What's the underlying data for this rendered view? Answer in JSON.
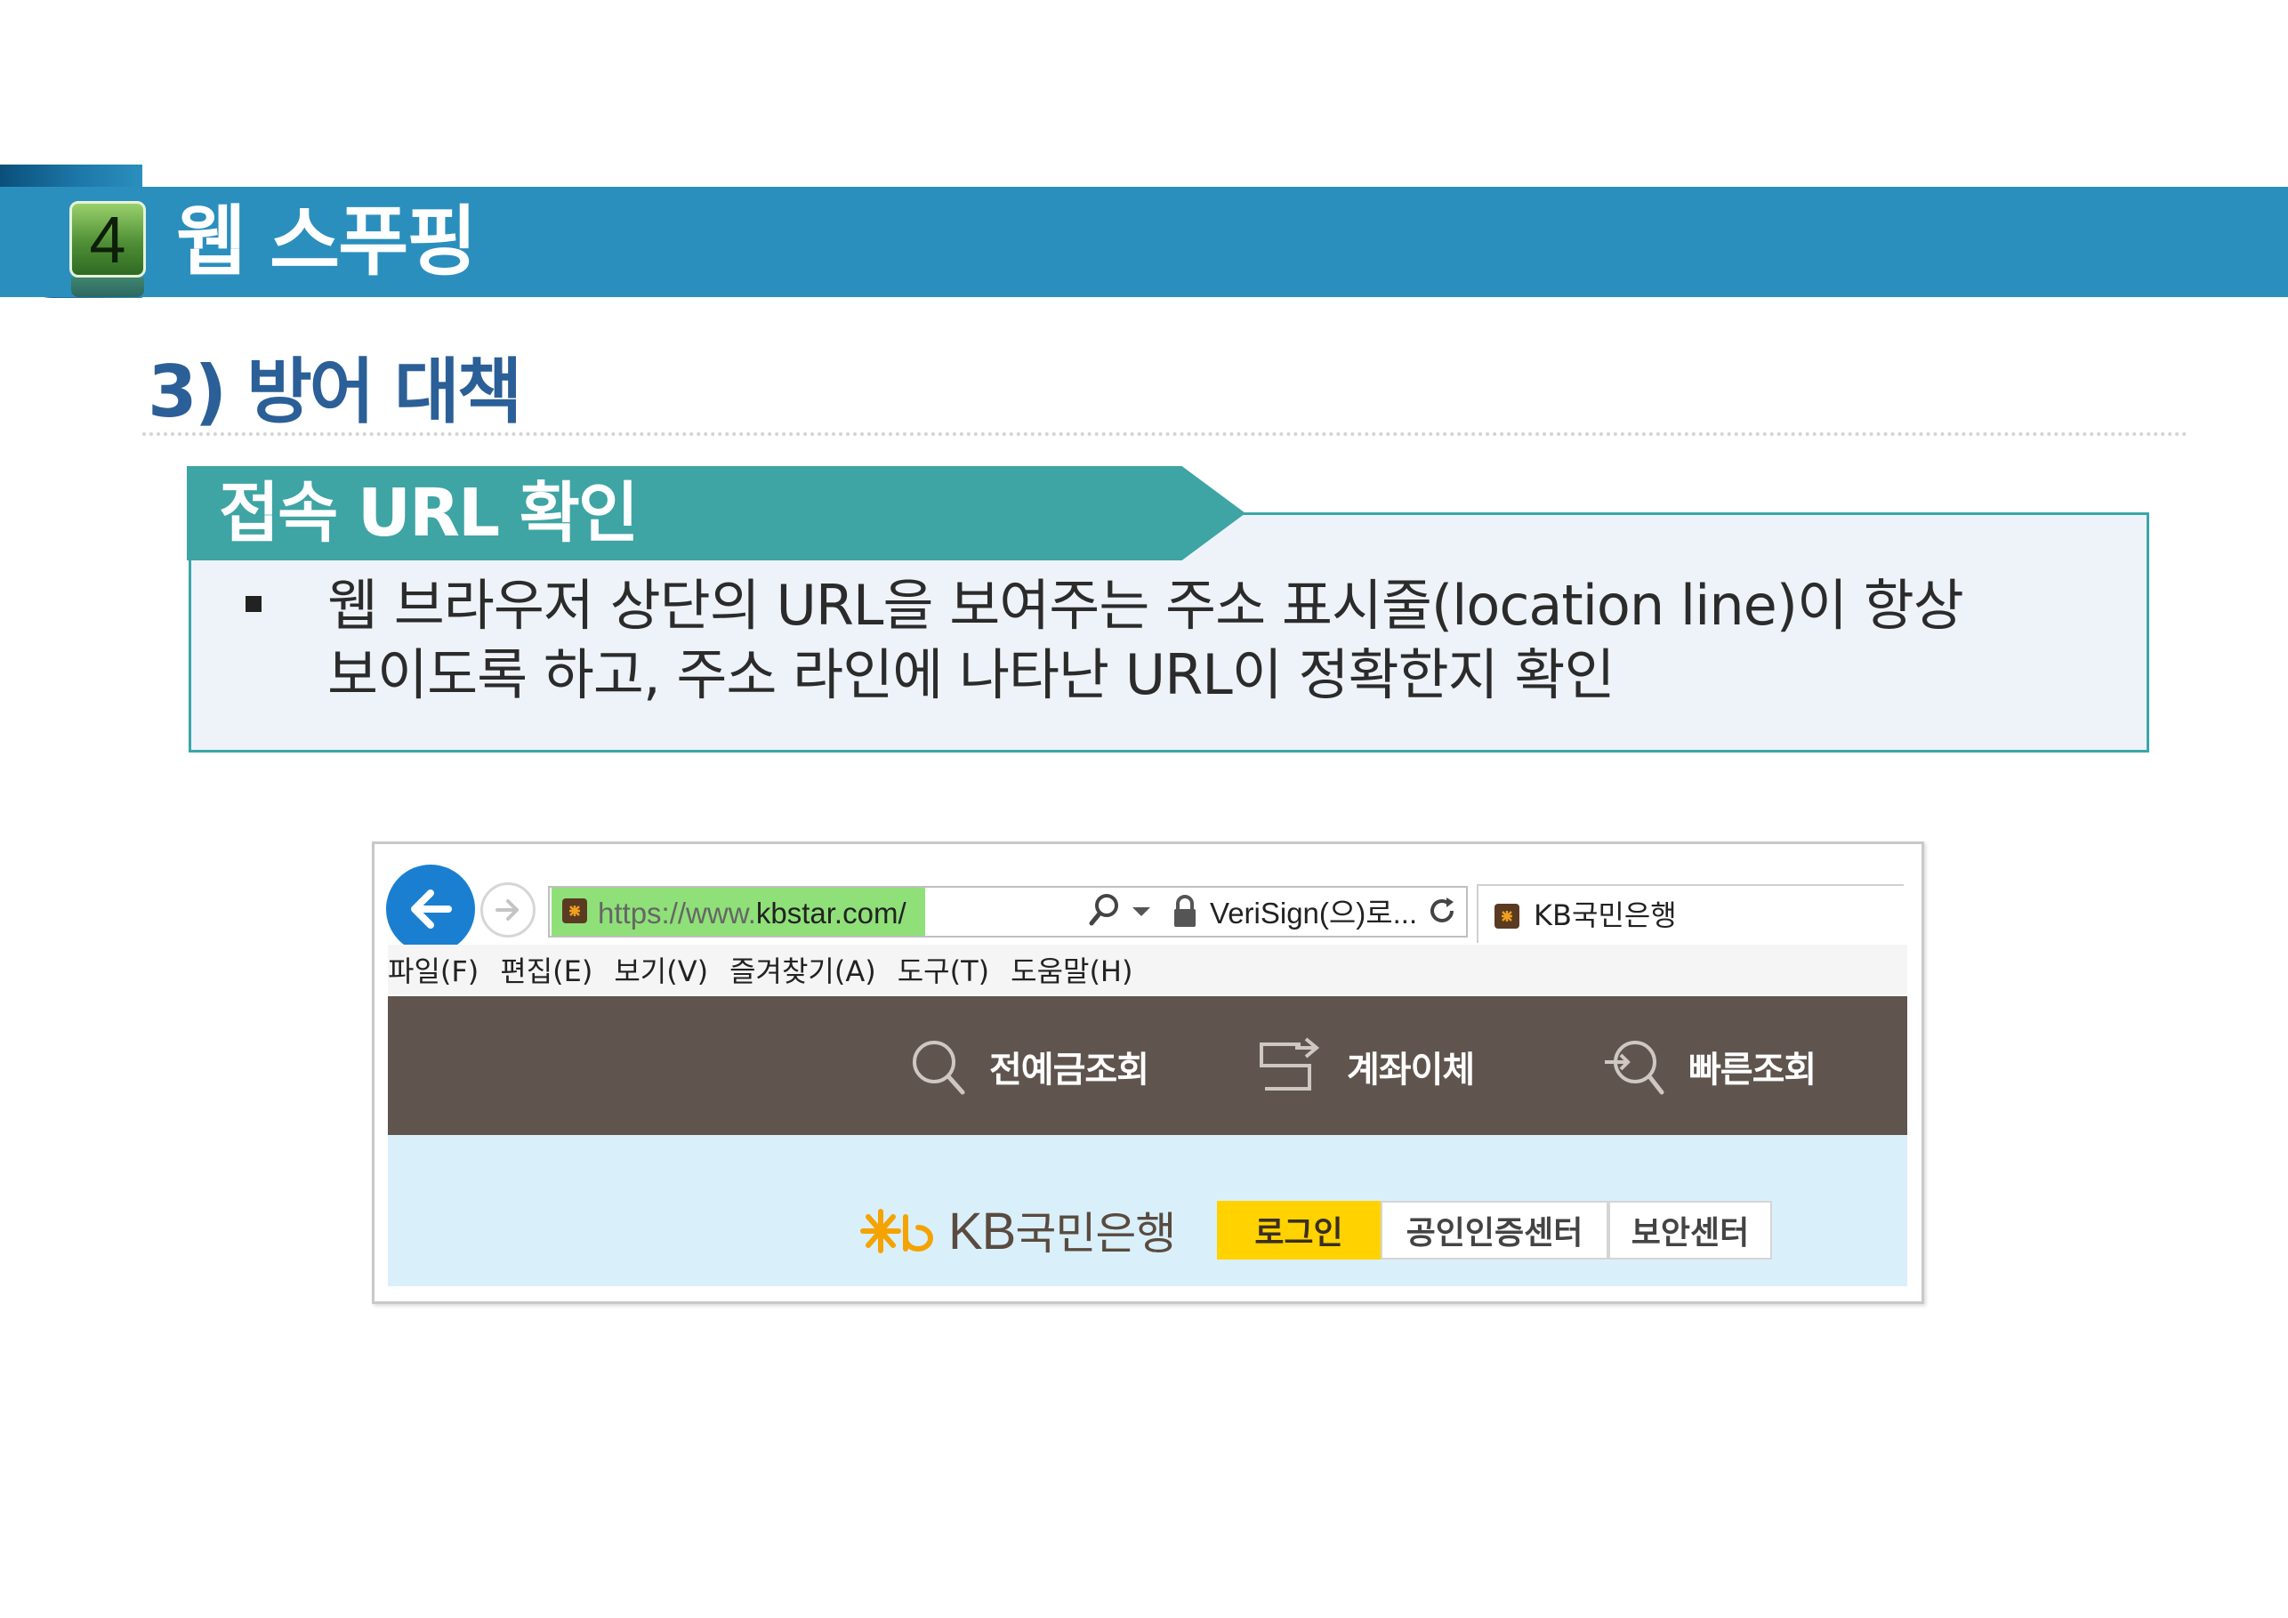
{
  "header": {
    "section_number": "4",
    "section_title": "웹 스푸핑"
  },
  "subtitle": "3) 방어 대책",
  "content_box": {
    "tab_label": "접속 URL 확인",
    "text_line1": "웹 브라우저 상단의 URL을 보여주는 주소 표시줄(location line)이 항상",
    "text_line2": "보이도록 하고, 주소 라인에 나타난 URL이 정확한지 확인"
  },
  "browser": {
    "url_prefix": "https://www.",
    "url_domain": "kbstar.com/",
    "certificate": "VeriSign(으)로...",
    "tab_title": "KB국민은행",
    "menu": [
      "파일(F)",
      "편집(E)",
      "보기(V)",
      "즐겨찾기(A)",
      "도구(T)",
      "도움말(H)"
    ],
    "nav_items": [
      "전예금조회",
      "계좌이체",
      "빠른조회"
    ],
    "site_logo_letters": "KB",
    "site_logo_name": "국민은행",
    "site_buttons": [
      "로그인",
      "공인인증센터",
      "보안센터"
    ],
    "colors": {
      "nav_band": "#5f554e",
      "site_bg": "#d9f0fb",
      "login_button": "#ffd200",
      "address_secure": "#8fe078"
    }
  }
}
